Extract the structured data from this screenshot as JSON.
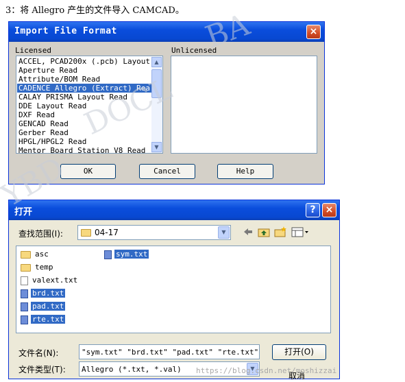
{
  "caption": "3：将 Allegro 产生的文件导入 CAMCAD。",
  "import_dialog": {
    "title": "Import File Format",
    "close_label": "×",
    "licensed_label": "Licensed",
    "unlicensed_label": "Unlicensed",
    "licensed_items": [
      "ACCEL, PCAD200x (.pcb) Layout",
      "Aperture Read",
      "Attribute/BOM Read",
      "CADENCE Allegro (Extract) Rea",
      "CALAY PRISMA Layout Read",
      "DDE Layout Read",
      "DXF Read",
      "GENCAD Read",
      "Gerber Read",
      "HPGL/HPGL2 Read",
      "Mentor Board Station V8 Read"
    ],
    "selected_index": 3,
    "ok_label": "OK",
    "cancel_label": "Cancel",
    "help_label": "Help"
  },
  "open_dialog": {
    "title": "打开",
    "help_label": "?",
    "close_label": "×",
    "look_in_label": "查找范围(I):",
    "look_in_value": "04-17",
    "files": [
      {
        "name": "asc",
        "type": "folder",
        "selected": false
      },
      {
        "name": "temp",
        "type": "folder",
        "selected": false
      },
      {
        "name": "valext.txt",
        "type": "file",
        "selected": false
      },
      {
        "name": "brd.txt",
        "type": "file",
        "selected": true
      },
      {
        "name": "pad.txt",
        "type": "file",
        "selected": true
      },
      {
        "name": "rte.txt",
        "type": "file",
        "selected": true
      },
      {
        "name": "sym.txt",
        "type": "file",
        "selected": true
      }
    ],
    "filename_label": "文件名(N):",
    "filename_value": "\"sym.txt\" \"brd.txt\" \"pad.txt\" \"rte.txt\"",
    "filetype_label": "文件类型(T):",
    "filetype_value": "Allegro (*.txt, *.val)",
    "open_label": "打开(O)",
    "cancel_label": "取消"
  },
  "watermark": {
    "text_1": "BA",
    "text_2": "DOCL",
    "text_3": "YBD",
    "url": "https://blog.csdn.net/moshizzai"
  },
  "icons": [
    "back-arrow-icon",
    "up-folder-icon",
    "new-folder-icon",
    "views-menu-icon"
  ]
}
